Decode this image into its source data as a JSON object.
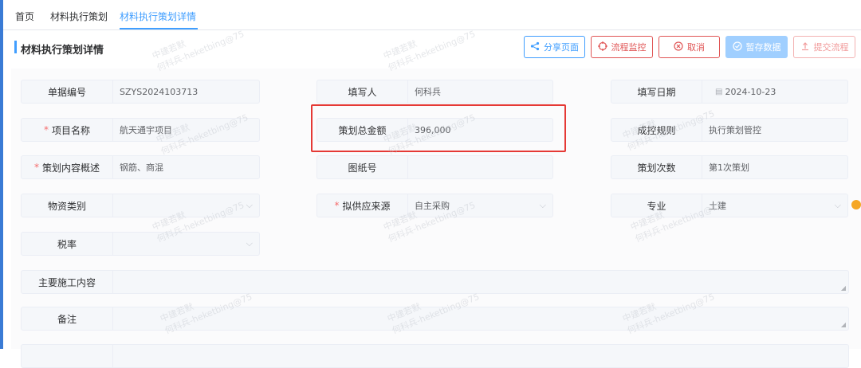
{
  "tabs": [
    {
      "label": "首页"
    },
    {
      "label": "材料执行策划"
    },
    {
      "label": "材料执行策划详情"
    }
  ],
  "page_title": "材料执行策划详情",
  "buttons": {
    "share": "分享页面",
    "monitor": "流程监控",
    "cancel": "取消",
    "save": "暂存数据",
    "submit": "提交流程"
  },
  "icons": {
    "share": "share-icon",
    "monitor": "target-icon",
    "cancel": "close-circle-icon",
    "save": "check-circle-icon",
    "submit": "upload-icon"
  },
  "form": {
    "doc_no": {
      "label": "单据编号",
      "value": "SZYS2024103713"
    },
    "filler": {
      "label": "填写人",
      "value": "何科兵"
    },
    "fill_date": {
      "label": "填写日期",
      "value": "2024-10-23"
    },
    "project_name": {
      "label": "项目名称",
      "required": "*",
      "value": "航天通宇项目"
    },
    "total_amount": {
      "label": "策划总金额",
      "value": "396,000"
    },
    "cost_rule": {
      "label": "成控规则",
      "value": "执行策划管控"
    },
    "content_summary": {
      "label": "策划内容概述",
      "required": "*",
      "value": "钢筋、商混"
    },
    "drawing_no": {
      "label": "图纸号",
      "value": ""
    },
    "plan_count": {
      "label": "策划次数",
      "value": "第1次策划"
    },
    "material_type": {
      "label": "物资类别",
      "value": ""
    },
    "supply_source": {
      "label": "拟供应来源",
      "required": "*",
      "value": "自主采购"
    },
    "specialty": {
      "label": "专业",
      "value": "土建"
    },
    "tax_rate": {
      "label": "税率",
      "value": ""
    },
    "main_work": {
      "label": "主要施工内容",
      "value": ""
    },
    "remarks": {
      "label": "备注",
      "value": ""
    }
  },
  "watermark": {
    "line1": "中建若默",
    "line2": "何科兵-heketbing@75"
  },
  "colors": {
    "primary": "#409eff",
    "danger": "#e05555",
    "highlight": "#e53935",
    "accent_dot": "#f5a623"
  }
}
